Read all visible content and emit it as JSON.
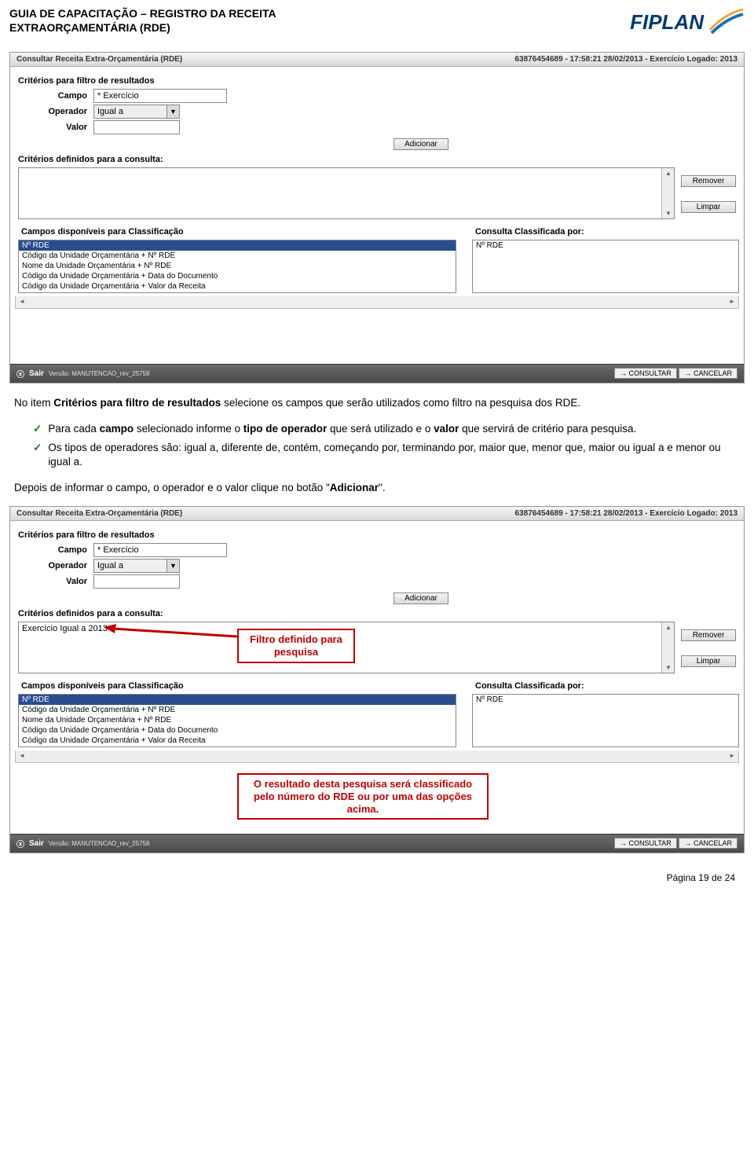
{
  "doc": {
    "title_line1": "GUIA DE CAPACITAÇÃO – REGISTRO DA RECEITA",
    "title_line2": "EXTRAORÇAMENTÁRIA (RDE)",
    "logo_text": "FIPLAN",
    "page_number": "Página 19 de 24"
  },
  "app": {
    "title": "Consultar Receita Extra-Orçamentária (RDE)",
    "header_right": "63876454689 - 17:58:21 28/02/2013 - Exercício Logado: 2013",
    "filter_section": "Critérios para filtro de resultados",
    "field_campo_label": "Campo",
    "field_campo_value": "* Exercício",
    "field_operador_label": "Operador",
    "field_operador_value": "Igual a",
    "field_valor_label": "Valor",
    "field_valor_value": "",
    "btn_adicionar": "Adicionar",
    "criteria_defined_label": "Critérios definidos para a consulta:",
    "criteria_text_1": "",
    "criteria_text_2": "Exercício Igual a 2013",
    "btn_remover": "Remover",
    "btn_limpar": "Limpar",
    "class_avail_label": "Campos disponíveis para Classificação",
    "class_by_label": "Consulta Classificada por:",
    "class_items": [
      "Nº RDE",
      "Código da Unidade Orçamentária + Nº RDE",
      "Nome da Unidade Orçamentária + Nº RDE",
      "Código da Unidade Orçamentária + Data do Documento",
      "Código da Unidade Orçamentária + Valor da Receita"
    ],
    "class_by_value": "Nº RDE",
    "footer_sair": "Sair",
    "footer_version": "Versão: MANUTENCAO_rev_25758",
    "footer_consultar": "CONSULTAR",
    "footer_cancelar": "CANCELAR"
  },
  "text": {
    "para1_a": "No item ",
    "para1_b": "Critérios para filtro de resultados",
    "para1_c": " selecione os campos que serão utilizados como filtro na pesquisa dos RDE.",
    "bullet1_a": "Para cada ",
    "bullet1_b": "campo",
    "bullet1_c": " selecionado informe o ",
    "bullet1_d": "tipo de operador",
    "bullet1_e": " que será utilizado e o ",
    "bullet1_f": "valor",
    "bullet1_g": " que servirá de critério para pesquisa.",
    "bullet2": "Os tipos de operadores são: igual a, diferente de, contém, começando por, terminando por, maior que, menor que, maior ou igual a e menor ou igual a.",
    "para2_a": "Depois de informar o campo, o operador e o valor clique no botão \"",
    "para2_b": "Adicionar",
    "para2_c": "\"."
  },
  "callouts": {
    "filter_defined": "Filtro definido para pesquisa",
    "result_note": "O resultado desta pesquisa será classificado pelo número do RDE  ou por uma das opções acima."
  }
}
